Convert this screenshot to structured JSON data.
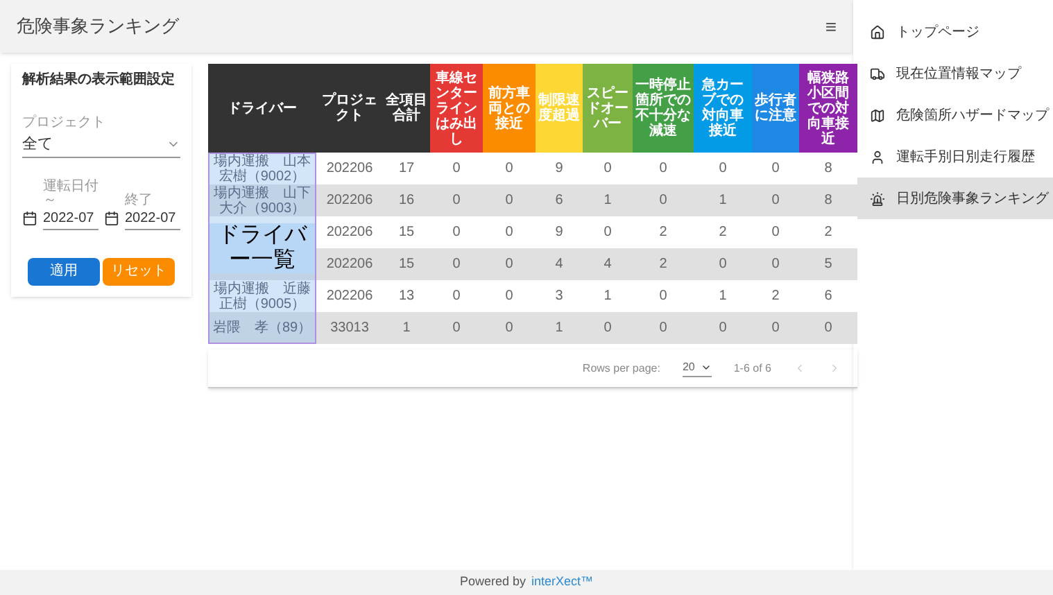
{
  "header": {
    "title": "危険事象ランキング",
    "menu": "≡"
  },
  "filter": {
    "title": "解析結果の表示範囲設定",
    "project": {
      "label": "プロジェクト",
      "value": "全て"
    },
    "start": {
      "label": "運転日付～",
      "value": "2022-07"
    },
    "end": {
      "label": "終了",
      "value": "2022-07"
    },
    "apply": "適用",
    "reset": "リセット"
  },
  "table": {
    "columns": [
      {
        "label": "ドライバー",
        "color": "#333333"
      },
      {
        "label": "プロジェクト",
        "color": "#333333"
      },
      {
        "label": "全項目合計",
        "color": "#333333"
      },
      {
        "label": "車線センターラインはみ出し",
        "color": "#e53935"
      },
      {
        "label": "前方車両との接近",
        "color": "#fb8c00"
      },
      {
        "label": "制限速度超過",
        "color": "#fdd835"
      },
      {
        "label": "スピードオーバー",
        "color": "#7cb342"
      },
      {
        "label": "一時停止箇所での不十分な減速",
        "color": "#43a047"
      },
      {
        "label": "急カーブでの対向車接近",
        "color": "#039be5"
      },
      {
        "label": "歩行者に注意",
        "color": "#1e88e5"
      },
      {
        "label": "幅狭路小区間での対向車接近",
        "color": "#8e24aa"
      }
    ],
    "rows": [
      {
        "cells": [
          "場内運搬　山本宏樹（9002）",
          "202206",
          "17",
          "0",
          "0",
          "9",
          "0",
          "0",
          "0",
          "0",
          "8"
        ]
      },
      {
        "cells": [
          "場内運搬　山下大介（9003）",
          "202206",
          "16",
          "0",
          "0",
          "6",
          "1",
          "0",
          "1",
          "0",
          "8"
        ]
      },
      {
        "cells": [
          "",
          "202206",
          "15",
          "0",
          "0",
          "9",
          "0",
          "2",
          "2",
          "0",
          "2"
        ]
      },
      {
        "cells": [
          "",
          "202206",
          "15",
          "0",
          "0",
          "4",
          "4",
          "2",
          "0",
          "0",
          "5"
        ]
      },
      {
        "cells": [
          "場内運搬　近藤正樹（9005）",
          "202206",
          "13",
          "0",
          "0",
          "3",
          "1",
          "0",
          "1",
          "2",
          "6"
        ]
      },
      {
        "cells": [
          "岩隈　孝（89）",
          "33013",
          "1",
          "0",
          "0",
          "1",
          "0",
          "0",
          "0",
          "0",
          "0"
        ]
      }
    ],
    "overlay": "ドライバー一覧",
    "pagination": {
      "label": "Rows per page:",
      "value": "20",
      "range": "1-6 of 6"
    }
  },
  "nav": [
    {
      "label": "トップページ",
      "selected": false
    },
    {
      "label": "現在位置情報マップ",
      "selected": false
    },
    {
      "label": "危険箇所ハザードマップ",
      "selected": false
    },
    {
      "label": "運転手別日別走行履歴",
      "selected": false
    },
    {
      "label": "日別危険事象ランキング",
      "selected": true
    }
  ],
  "footer": {
    "text": "Powered by",
    "brand": "interXect™"
  }
}
